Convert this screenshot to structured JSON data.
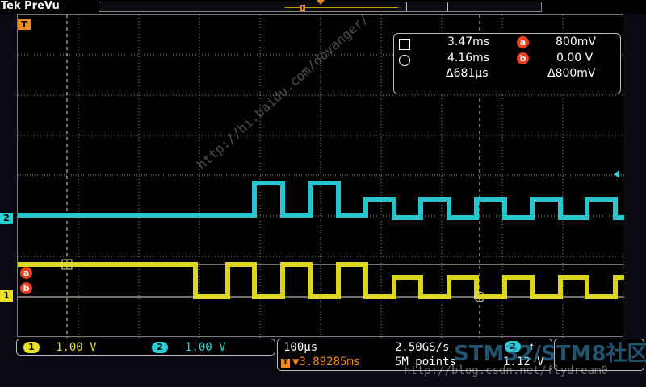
{
  "header": {
    "brand": "Tek",
    "mode": "PreVu"
  },
  "markers": {
    "trigger": "T",
    "ch1": "1",
    "ch2": "2",
    "cursor_a": "a",
    "cursor_b": "b"
  },
  "readout": {
    "t1": "3.47ms",
    "t2": "4.16ms",
    "dt": "Δ681µs",
    "v1": "800mV",
    "v2": "0.00 V",
    "dv": "Δ800mV",
    "badge_a": "a",
    "badge_b": "b"
  },
  "channels": [
    {
      "id": "1",
      "scale": "1.00 V",
      "color": "#e8e020"
    },
    {
      "id": "2",
      "scale": "1.00 V",
      "color": "#2ad0d8"
    }
  ],
  "timebase": {
    "scale": "100µs",
    "sample_rate": "2.50GS/s",
    "position": "▼3.89285ms",
    "record_length": "5M points"
  },
  "trigger": {
    "source": "2",
    "slope": "↑",
    "level": "1.12 V"
  },
  "watermark": {
    "url": "http://blog.csdn.net/flydream0",
    "logo": "STM32/STM8社区",
    "diagonal": "http://hi.baidu.com/dovanger/"
  },
  "colors": {
    "ch1": "#e8e020",
    "ch2": "#2ad0d8",
    "trigger": "#f08a1c",
    "cursor": "#e84020",
    "grid": "#c8c8c8"
  }
}
